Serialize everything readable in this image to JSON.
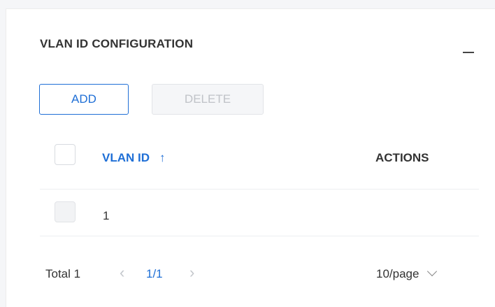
{
  "panel": {
    "title": "VLAN ID CONFIGURATION",
    "collapse_icon": "minus-icon"
  },
  "toolbar": {
    "add_label": "ADD",
    "delete_label": "DELETE"
  },
  "table": {
    "columns": [
      {
        "label": "VLAN ID",
        "sort": "ascending",
        "sort_icon": "↑"
      },
      {
        "label": "ACTIONS"
      }
    ],
    "rows": [
      {
        "vlan_id": "1",
        "actions": ""
      }
    ]
  },
  "pagination": {
    "total_text": "Total 1",
    "current": "1/1",
    "page_size": "10/page",
    "prev_icon": "‹",
    "next_icon": "›"
  },
  "colors": {
    "accent": "#1f6fd6",
    "text": "#333333",
    "disabled_text": "#c0c3c8"
  }
}
